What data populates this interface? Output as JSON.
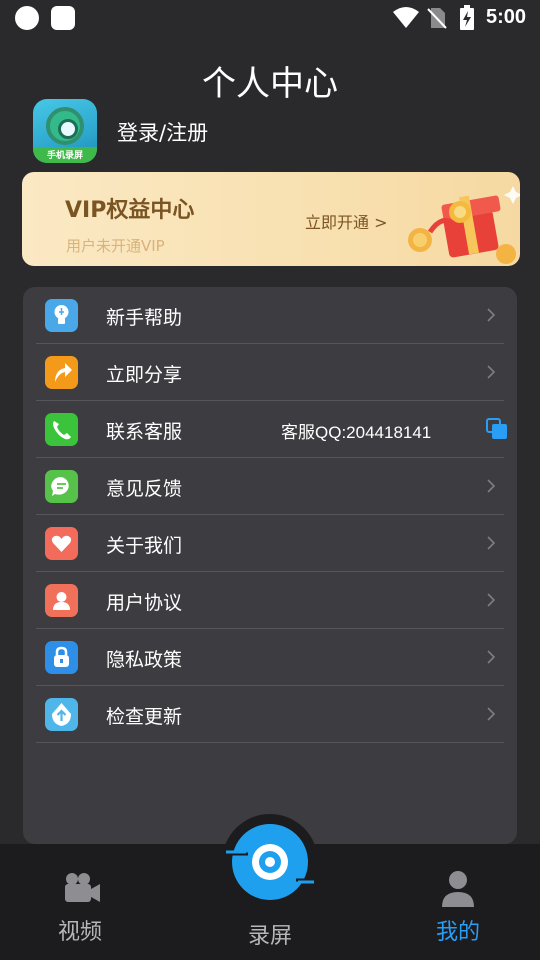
{
  "status_bar": {
    "time": "5:00"
  },
  "page": {
    "title": "个人中心"
  },
  "profile": {
    "login_label": "登录/注册",
    "logo_text": "手机录屏"
  },
  "vip": {
    "title": "VIP权益中心",
    "subtitle": "用户未开通VIP",
    "button_label": "立即开通 >"
  },
  "menu": {
    "items": [
      {
        "label": "新手帮助",
        "icon": "lightbulb-icon",
        "color": "#4aa8e8"
      },
      {
        "label": "立即分享",
        "icon": "share-arrow-icon",
        "color": "#f39a1a"
      },
      {
        "label": "联系客服",
        "icon": "phone-icon",
        "color": "#3bc43b",
        "extra": "客服QQ:204418141"
      },
      {
        "label": "意见反馈",
        "icon": "chat-bubble-icon",
        "color": "#56c24a"
      },
      {
        "label": "关于我们",
        "icon": "heart-icon",
        "color": "#f26b5b"
      },
      {
        "label": "用户协议",
        "icon": "user-icon",
        "color": "#f0705a"
      },
      {
        "label": "隐私政策",
        "icon": "lock-icon",
        "color": "#2e8fe8"
      },
      {
        "label": "检查更新",
        "icon": "upload-icon",
        "color": "#4fb6ea"
      }
    ]
  },
  "bottom_nav": {
    "video_label": "视频",
    "record_label": "录屏",
    "mine_label": "我的",
    "active_color": "#2a9df4",
    "inactive_color": "#b7b7bb"
  }
}
